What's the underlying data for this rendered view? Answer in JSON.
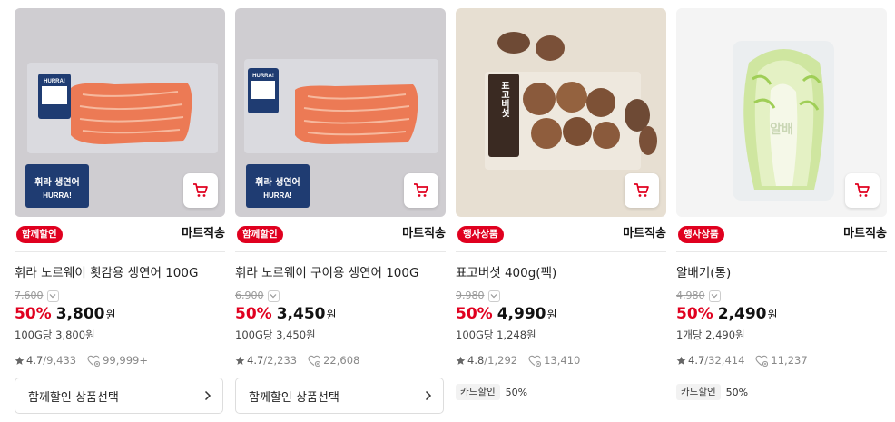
{
  "products": [
    {
      "badge": "함께할인",
      "seller": "마트직송",
      "name": "휘라 노르웨이 횟감용 생연어 100G",
      "original_price": "7,600",
      "discount": "50%",
      "price": "3,800",
      "currency": "원",
      "unit_price": "100G당 3,800원",
      "rating": "4.7",
      "reviews": "9,433",
      "likes": "99,999+",
      "cta_label": "함께할인 상품선택",
      "image": {
        "label_top": "HURRA!",
        "label_bottom_1": "휘라 생연어",
        "label_bottom_2": "HURRA!"
      }
    },
    {
      "badge": "함께할인",
      "seller": "마트직송",
      "name": "휘라 노르웨이 구이용 생연어 100G",
      "original_price": "6,900",
      "discount": "50%",
      "price": "3,450",
      "currency": "원",
      "unit_price": "100G당 3,450원",
      "rating": "4.7",
      "reviews": "2,233",
      "likes": "22,608",
      "cta_label": "함께할인 상품선택",
      "image": {
        "label_top": "HURRA!",
        "label_bottom_1": "휘라 생연어",
        "label_bottom_2": "HURRA!"
      }
    },
    {
      "badge": "행사상품",
      "seller": "마트직송",
      "name": "표고버섯 400g(팩)",
      "original_price": "9,980",
      "discount": "50%",
      "price": "4,990",
      "currency": "원",
      "unit_price": "100G당 1,248원",
      "rating": "4.8",
      "reviews": "1,292",
      "likes": "13,410",
      "card_tag": "카드할인",
      "card_discount": "50%",
      "image": {
        "label": "표고버섯"
      }
    },
    {
      "badge": "행사상품",
      "seller": "마트직송",
      "name": "알배기(통)",
      "original_price": "4,980",
      "discount": "50%",
      "price": "2,490",
      "currency": "원",
      "unit_price": "1개당 2,490원",
      "rating": "4.7",
      "reviews": "32,414",
      "likes": "11,237",
      "card_tag": "카드할인",
      "card_discount": "50%",
      "image": {
        "label": "알배"
      }
    }
  ],
  "icons": {
    "cart": "cart-icon",
    "star": "star-icon",
    "like": "heart-icon",
    "chevron": "chevron-right-icon",
    "dropdown": "chevron-down-icon"
  },
  "colors": {
    "accent": "#e0001f",
    "badge_text": "#ffffff",
    "muted": "#999999"
  }
}
